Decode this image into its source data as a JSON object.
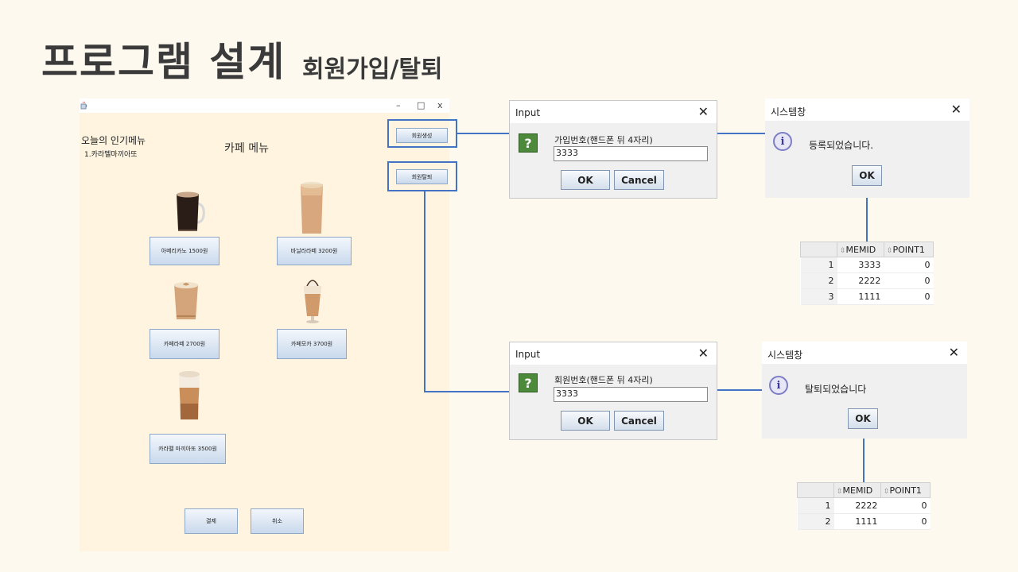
{
  "slide": {
    "title": "프로그램 설계",
    "subtitle": "회원가입/탈퇴"
  },
  "app": {
    "titlebar_icon": "java-cup-icon",
    "window_controls": {
      "minimize": "–",
      "maximize": "□",
      "close": "x"
    },
    "popular_title": "오늘의 인기메뉴",
    "popular_item": "1.카라멜마끼아또",
    "menu_title": "카페 메뉴",
    "items": [
      {
        "label": "아메리카노  1500원",
        "icon": "americano-cup-icon"
      },
      {
        "label": "바닐라라떼  3200원",
        "icon": "vanilla-latte-glass-icon"
      },
      {
        "label": "카페라떼  2700원",
        "icon": "cafe-latte-cup-icon"
      },
      {
        "label": "카페모카  3700원",
        "icon": "cafe-mocha-glass-icon"
      },
      {
        "label": "카라멜 마끼아또  3500원",
        "icon": "caramel-macchiato-glass-icon"
      }
    ],
    "join_button": "회원생성",
    "leave_button": "회원탈퇴",
    "pay_button": "결제",
    "cancel_button": "취소"
  },
  "join_input_dialog": {
    "title": "Input",
    "close": "✕",
    "icon_glyph": "?",
    "prompt": "가입번호(핸드폰 뒤 4자리)",
    "value": "3333",
    "ok": "OK",
    "cancel": "Cancel"
  },
  "join_result_dialog": {
    "title": "시스템창",
    "close": "✕",
    "icon_glyph": "i",
    "message": "등록되었습니다.",
    "ok": "OK"
  },
  "join_table": {
    "columns": [
      "MEMID",
      "POINT1"
    ],
    "rows": [
      {
        "n": "1",
        "memid": "3333",
        "point": "0"
      },
      {
        "n": "2",
        "memid": "2222",
        "point": "0"
      },
      {
        "n": "3",
        "memid": "1111",
        "point": "0"
      }
    ]
  },
  "leave_input_dialog": {
    "title": "Input",
    "close": "✕",
    "icon_glyph": "?",
    "prompt": "회원번호(핸드폰 뒤 4자리)",
    "value": "3333",
    "ok": "OK",
    "cancel": "Cancel"
  },
  "leave_result_dialog": {
    "title": "시스템창",
    "close": "✕",
    "icon_glyph": "i",
    "message": "탈퇴되었습니다",
    "ok": "OK"
  },
  "leave_table": {
    "columns": [
      "MEMID",
      "POINT1"
    ],
    "rows": [
      {
        "n": "1",
        "memid": "2222",
        "point": "0"
      },
      {
        "n": "2",
        "memid": "1111",
        "point": "0"
      }
    ]
  },
  "colors": {
    "accent": "#4472c4",
    "background": "#fdf9ef",
    "app_bg": "#fef4e0"
  }
}
